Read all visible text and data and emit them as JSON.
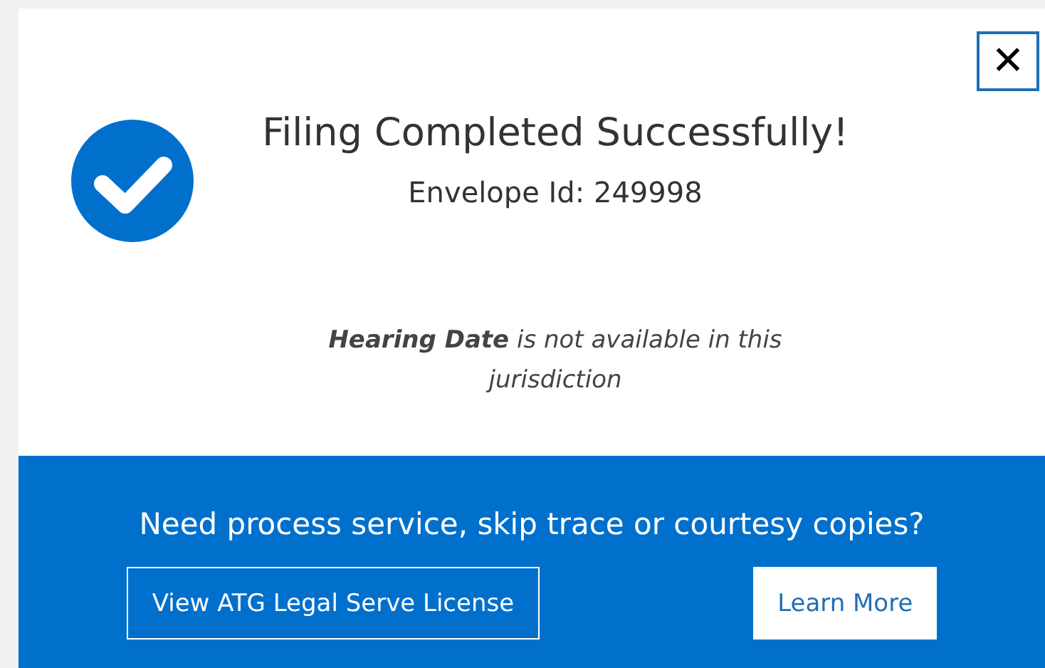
{
  "dialog": {
    "title": "Filing Completed Successfully!",
    "envelope": "Envelope Id: 249998",
    "note": "**Hearing Date** is not available in this jurisdiction",
    "close": "✕"
  },
  "banner": {
    "text": "Need process service, skip trace or courtesy copies?",
    "buttons": [
      {
        "label": "View ATG Legal Serve License",
        "kind": "outline"
      },
      {
        "label": "Learn More",
        "kind": "solid"
      }
    ]
  }
}
